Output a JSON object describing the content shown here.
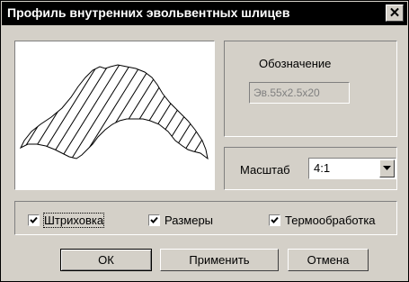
{
  "window": {
    "title": "Профиль внутренних эвольвентных шлицев",
    "close_glyph": "✕"
  },
  "designation": {
    "label": "Обозначение",
    "value": "Эв.55x2.5x20"
  },
  "scale": {
    "label": "Масштаб",
    "selected": "4:1"
  },
  "options": {
    "hatching": {
      "label": "Штриховка",
      "checked": true
    },
    "dimensions": {
      "label": "Размеры",
      "checked": true
    },
    "heat_treatment": {
      "label": "Термообработка",
      "checked": true
    }
  },
  "buttons": {
    "ok": "ОК",
    "apply": "Применить",
    "cancel": "Отмена"
  },
  "icons": {
    "preview": "spline-profile-preview",
    "checkmark": "check-icon",
    "dropdown": "chevron-down-icon",
    "close": "close-icon"
  }
}
